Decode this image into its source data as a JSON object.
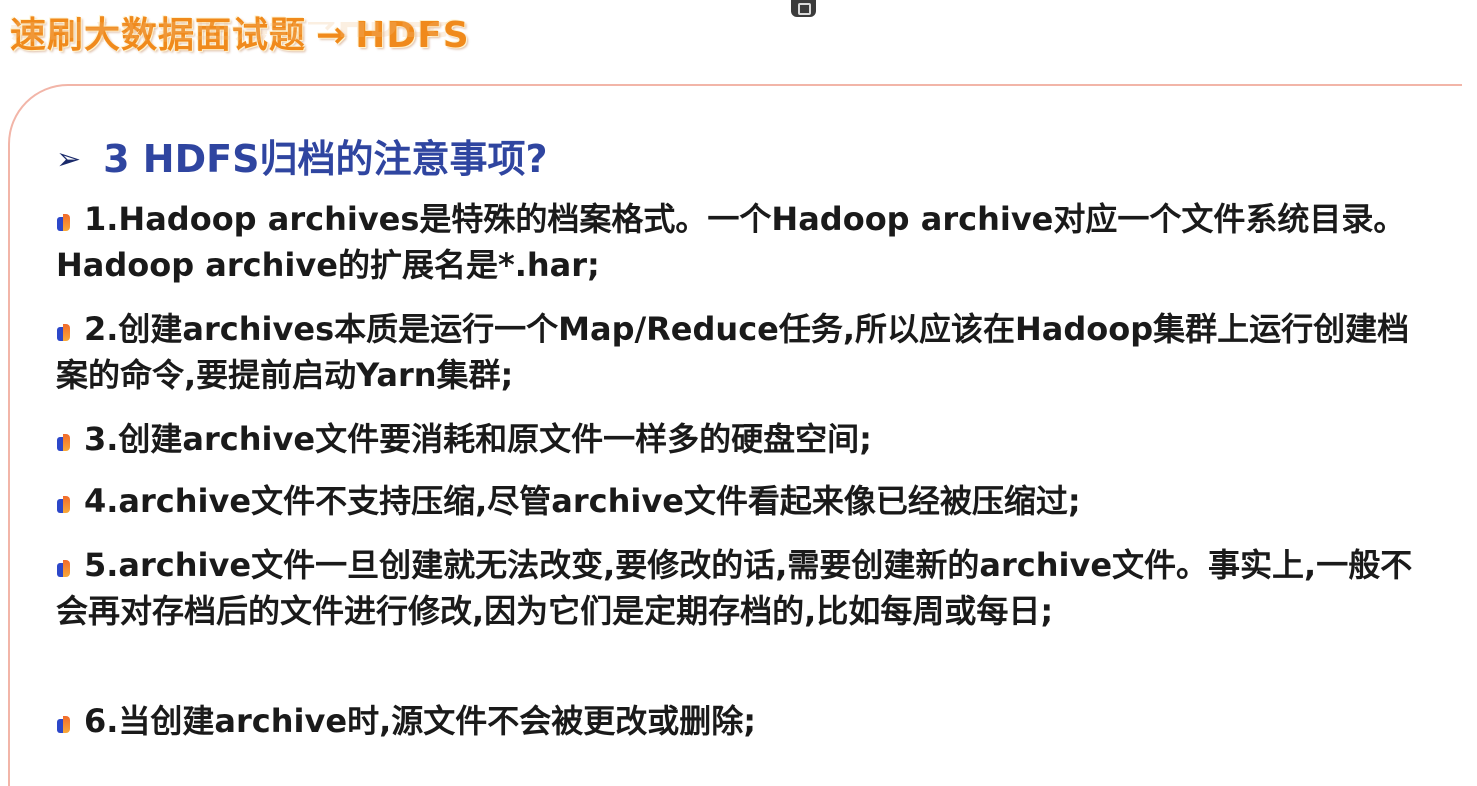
{
  "header": {
    "title": "速刷大数据面试题",
    "arrow": "→",
    "topic": "HDFS"
  },
  "question": {
    "marker": "➢",
    "text": "3 HDFS归档的注意事项?"
  },
  "items": [
    "1.Hadoop archives是特殊的档案格式。一个Hadoop archive对应一个文件系统目录。Hadoop archive的扩展名是*.har;",
    "2.创建archives本质是运行一个Map/Reduce任务,所以应该在Hadoop集群上运行创建档案的命令,要提前启动Yarn集群;",
    "3.创建archive文件要消耗和原文件一样多的硬盘空间;",
    "4.archive文件不支持压缩,尽管archive文件看起来像已经被压缩过;",
    "5.archive文件一旦创建就无法改变,要修改的话,需要创建新的archive文件。事实上,一般不会再对存档后的文件进行修改,因为它们是定期存档的,比如每周或每日;",
    "6.当创建archive时,源文件不会被更改或删除;"
  ],
  "colors": {
    "banner": "#f08a1c",
    "question": "#2f45a0",
    "card_border": "#f2b5a8",
    "body_text": "#1a1a1a"
  }
}
